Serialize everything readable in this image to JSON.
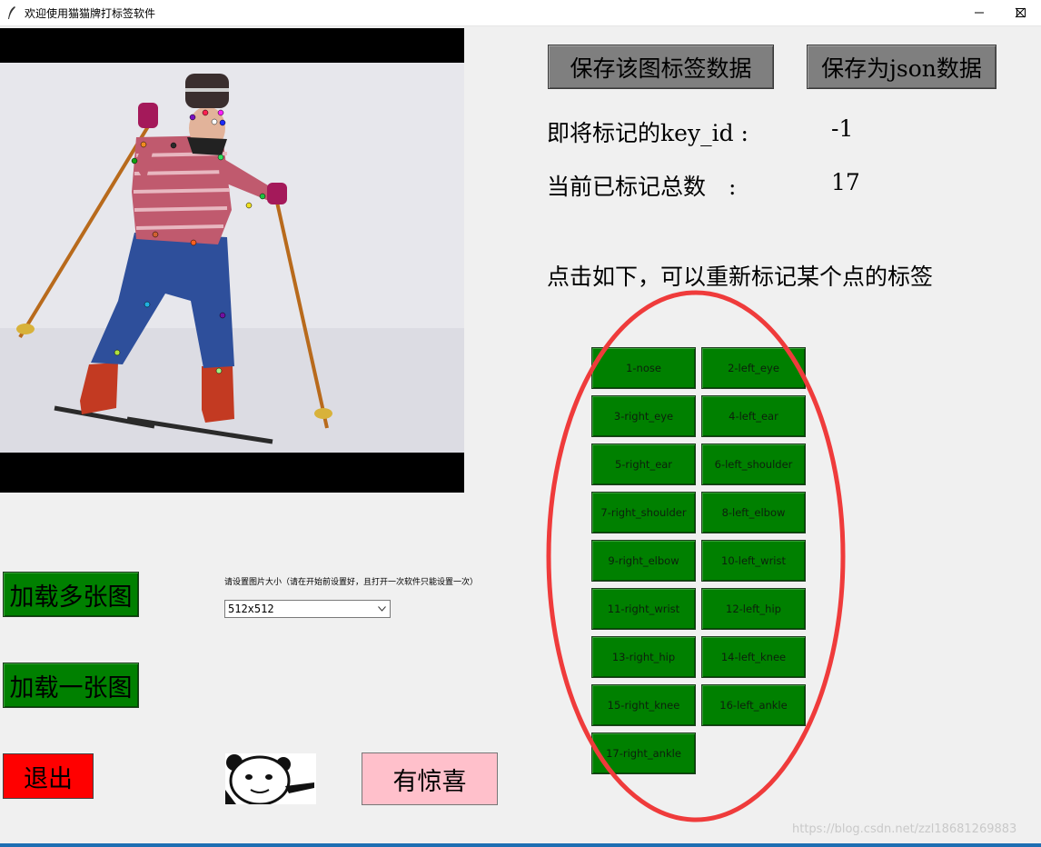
{
  "window": {
    "title": "欢迎使用猫猫牌打标签软件",
    "controls": [
      "minimize-icon",
      "maximize-icon",
      "close-icon"
    ]
  },
  "toolbar": {
    "save_label": "保存该图标签数据",
    "save_json_label": "保存为json数据"
  },
  "status": {
    "key_id_label": "即将标记的key_id :",
    "key_id_value": "-1",
    "total_label": "当前已标记总数　:",
    "total_value": "17",
    "relabel_hint": "点击如下，可以重新标记某个点的标签"
  },
  "keypoints": [
    {
      "label": "1-nose"
    },
    {
      "label": "2-left_eye"
    },
    {
      "label": "3-right_eye"
    },
    {
      "label": "4-left_ear"
    },
    {
      "label": "5-right_ear"
    },
    {
      "label": "6-left_shoulder"
    },
    {
      "label": "7-right_shoulder"
    },
    {
      "label": "8-left_elbow"
    },
    {
      "label": "9-right_elbow"
    },
    {
      "label": "10-left_wrist"
    },
    {
      "label": "11-right_wrist"
    },
    {
      "label": "12-left_hip"
    },
    {
      "label": "13-right_hip"
    },
    {
      "label": "14-left_knee"
    },
    {
      "label": "15-right_knee"
    },
    {
      "label": "16-left_ankle"
    },
    {
      "label": "17-right_ankle"
    }
  ],
  "left_panel": {
    "load_multi_label": "加载多张图",
    "load_one_label": "加载一张图",
    "quit_label": "退出"
  },
  "size_setting": {
    "label": "请设置图片大小（请在开始前设置好，且打开一次软件只能设置一次）",
    "selected": "512x512"
  },
  "extras": {
    "surprise_label": "有惊喜",
    "watermark": "https://blog.csdn.net/zzl18681269883"
  },
  "colors": {
    "green_button": "#008000",
    "gray_button": "#7f7f7f",
    "quit_button": "#ff0000",
    "surprise_button": "#ffc0cb",
    "annotation_ellipse": "#ef3b3b"
  }
}
